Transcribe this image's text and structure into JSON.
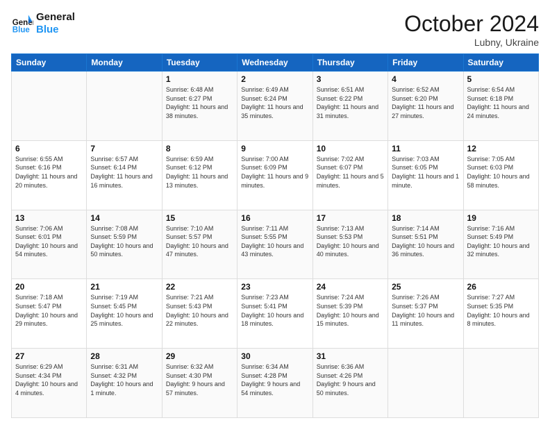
{
  "header": {
    "logo_general": "General",
    "logo_blue": "Blue",
    "month_title": "October 2024",
    "subtitle": "Lubny, Ukraine"
  },
  "days_of_week": [
    "Sunday",
    "Monday",
    "Tuesday",
    "Wednesday",
    "Thursday",
    "Friday",
    "Saturday"
  ],
  "weeks": [
    {
      "days": [
        {
          "number": "",
          "info": ""
        },
        {
          "number": "",
          "info": ""
        },
        {
          "number": "1",
          "info": "Sunrise: 6:48 AM\nSunset: 6:27 PM\nDaylight: 11 hours and 38 minutes."
        },
        {
          "number": "2",
          "info": "Sunrise: 6:49 AM\nSunset: 6:24 PM\nDaylight: 11 hours and 35 minutes."
        },
        {
          "number": "3",
          "info": "Sunrise: 6:51 AM\nSunset: 6:22 PM\nDaylight: 11 hours and 31 minutes."
        },
        {
          "number": "4",
          "info": "Sunrise: 6:52 AM\nSunset: 6:20 PM\nDaylight: 11 hours and 27 minutes."
        },
        {
          "number": "5",
          "info": "Sunrise: 6:54 AM\nSunset: 6:18 PM\nDaylight: 11 hours and 24 minutes."
        }
      ]
    },
    {
      "days": [
        {
          "number": "6",
          "info": "Sunrise: 6:55 AM\nSunset: 6:16 PM\nDaylight: 11 hours and 20 minutes."
        },
        {
          "number": "7",
          "info": "Sunrise: 6:57 AM\nSunset: 6:14 PM\nDaylight: 11 hours and 16 minutes."
        },
        {
          "number": "8",
          "info": "Sunrise: 6:59 AM\nSunset: 6:12 PM\nDaylight: 11 hours and 13 minutes."
        },
        {
          "number": "9",
          "info": "Sunrise: 7:00 AM\nSunset: 6:09 PM\nDaylight: 11 hours and 9 minutes."
        },
        {
          "number": "10",
          "info": "Sunrise: 7:02 AM\nSunset: 6:07 PM\nDaylight: 11 hours and 5 minutes."
        },
        {
          "number": "11",
          "info": "Sunrise: 7:03 AM\nSunset: 6:05 PM\nDaylight: 11 hours and 1 minute."
        },
        {
          "number": "12",
          "info": "Sunrise: 7:05 AM\nSunset: 6:03 PM\nDaylight: 10 hours and 58 minutes."
        }
      ]
    },
    {
      "days": [
        {
          "number": "13",
          "info": "Sunrise: 7:06 AM\nSunset: 6:01 PM\nDaylight: 10 hours and 54 minutes."
        },
        {
          "number": "14",
          "info": "Sunrise: 7:08 AM\nSunset: 5:59 PM\nDaylight: 10 hours and 50 minutes."
        },
        {
          "number": "15",
          "info": "Sunrise: 7:10 AM\nSunset: 5:57 PM\nDaylight: 10 hours and 47 minutes."
        },
        {
          "number": "16",
          "info": "Sunrise: 7:11 AM\nSunset: 5:55 PM\nDaylight: 10 hours and 43 minutes."
        },
        {
          "number": "17",
          "info": "Sunrise: 7:13 AM\nSunset: 5:53 PM\nDaylight: 10 hours and 40 minutes."
        },
        {
          "number": "18",
          "info": "Sunrise: 7:14 AM\nSunset: 5:51 PM\nDaylight: 10 hours and 36 minutes."
        },
        {
          "number": "19",
          "info": "Sunrise: 7:16 AM\nSunset: 5:49 PM\nDaylight: 10 hours and 32 minutes."
        }
      ]
    },
    {
      "days": [
        {
          "number": "20",
          "info": "Sunrise: 7:18 AM\nSunset: 5:47 PM\nDaylight: 10 hours and 29 minutes."
        },
        {
          "number": "21",
          "info": "Sunrise: 7:19 AM\nSunset: 5:45 PM\nDaylight: 10 hours and 25 minutes."
        },
        {
          "number": "22",
          "info": "Sunrise: 7:21 AM\nSunset: 5:43 PM\nDaylight: 10 hours and 22 minutes."
        },
        {
          "number": "23",
          "info": "Sunrise: 7:23 AM\nSunset: 5:41 PM\nDaylight: 10 hours and 18 minutes."
        },
        {
          "number": "24",
          "info": "Sunrise: 7:24 AM\nSunset: 5:39 PM\nDaylight: 10 hours and 15 minutes."
        },
        {
          "number": "25",
          "info": "Sunrise: 7:26 AM\nSunset: 5:37 PM\nDaylight: 10 hours and 11 minutes."
        },
        {
          "number": "26",
          "info": "Sunrise: 7:27 AM\nSunset: 5:35 PM\nDaylight: 10 hours and 8 minutes."
        }
      ]
    },
    {
      "days": [
        {
          "number": "27",
          "info": "Sunrise: 6:29 AM\nSunset: 4:34 PM\nDaylight: 10 hours and 4 minutes."
        },
        {
          "number": "28",
          "info": "Sunrise: 6:31 AM\nSunset: 4:32 PM\nDaylight: 10 hours and 1 minute."
        },
        {
          "number": "29",
          "info": "Sunrise: 6:32 AM\nSunset: 4:30 PM\nDaylight: 9 hours and 57 minutes."
        },
        {
          "number": "30",
          "info": "Sunrise: 6:34 AM\nSunset: 4:28 PM\nDaylight: 9 hours and 54 minutes."
        },
        {
          "number": "31",
          "info": "Sunrise: 6:36 AM\nSunset: 4:26 PM\nDaylight: 9 hours and 50 minutes."
        },
        {
          "number": "",
          "info": ""
        },
        {
          "number": "",
          "info": ""
        }
      ]
    }
  ]
}
